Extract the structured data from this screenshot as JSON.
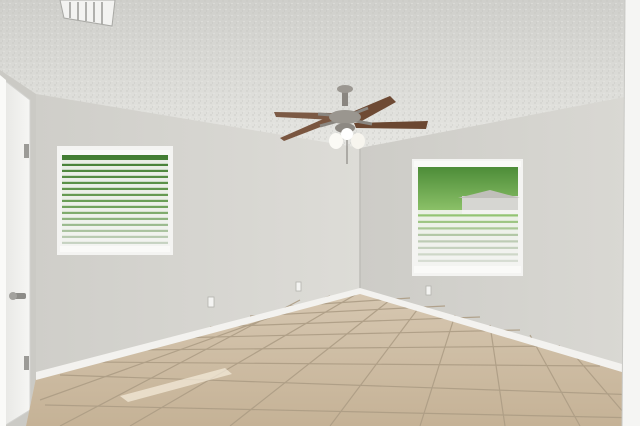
{
  "scene": {
    "type": "empty-room-interior",
    "features": [
      "ceiling-fan",
      "left-window-blinds",
      "right-window-blinds",
      "interior-door",
      "tile-floor",
      "baseboards",
      "textured-ceiling",
      "ceiling-vent",
      "wall-outlets"
    ]
  },
  "colors": {
    "ceiling": "#dcdcd8",
    "wall_left": "#d5d4cf",
    "wall_back": "#d2d1cc",
    "wall_right": "#cfcec9",
    "floor_tile": "#cdbca4",
    "grout": "#a89880",
    "baseboard": "#f2f1ee",
    "window_frame": "#f4f4f2",
    "blind_slat": "#f7f7f5",
    "foliage": "#4e8a3a",
    "fan_metal": "#8a8680",
    "fan_blade": "#6e4a34",
    "door": "#eeeeeb"
  }
}
